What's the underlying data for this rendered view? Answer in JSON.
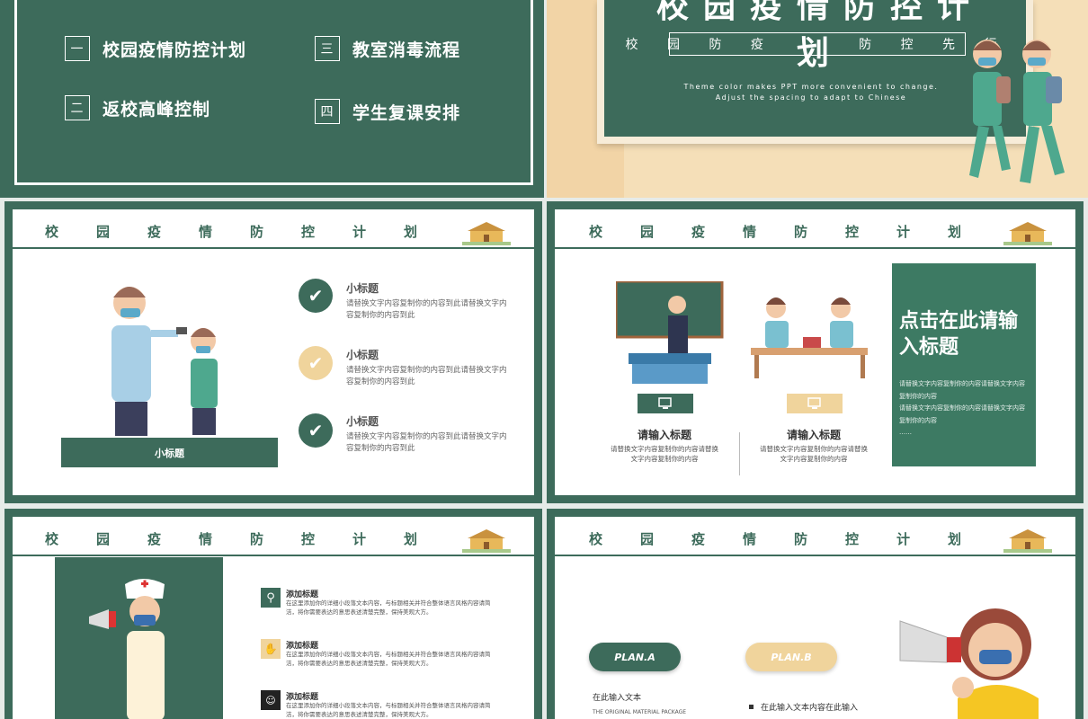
{
  "agenda": [
    {
      "num": "一",
      "label": "校园疫情防控计划"
    },
    {
      "num": "三",
      "label": "教室消毒流程"
    },
    {
      "num": "二",
      "label": "返校高峰控制"
    },
    {
      "num": "四",
      "label": "学生复课安排"
    }
  ],
  "cover": {
    "title": "校园疫情防控计划",
    "subtitle": "校 园 防 疫     防 控 先 行",
    "eng1": "Theme color makes PPT more convenient to change.",
    "eng2": "Adjust the spacing to adapt to Chinese"
  },
  "header_letters": [
    "校",
    "园",
    "疫",
    "情",
    "防",
    "控",
    "计",
    "划"
  ],
  "slide3": {
    "bar_label": "小标题",
    "items": [
      {
        "title": "小标题",
        "desc": "请替换文字内容复制你的内容到此请替换文字内容复制你的内容到此",
        "color": "#3d6b5b"
      },
      {
        "title": "小标题",
        "desc": "请替换文字内容复制你的内容到此请替换文字内容复制你的内容到此",
        "color": "#f0d49c"
      },
      {
        "title": "小标题",
        "desc": "请替换文字内容复制你的内容到此请替换文字内容复制你的内容到此",
        "color": "#3d6b5b"
      }
    ]
  },
  "slide4": {
    "col1_title": "请输入标题",
    "col1_desc": "请替换文字内容复制你的内容请替换文字内容复制你的内容",
    "col2_title": "请输入标题",
    "col2_desc": "请替换文字内容复制你的内容请替换文字内容复制你的内容",
    "panel_title": "点击在此请输入标题",
    "panel_desc": "请替换文字内容复制你的内容请替换文字内容复制你的内容\n请替换文字内容复制你的内容请替换文字内容复制你的内容\n……"
  },
  "slide5": {
    "items": [
      {
        "title": "添加标题",
        "desc": "在这里添加你的详细小段落文本内容，与标题相关并符合整体语言风格内容请简洁，将你需要表达的意思表述清楚完整，保持美观大方。"
      },
      {
        "title": "添加标题",
        "desc": "在这里添加你的详细小段落文本内容，与标题相关并符合整体语言风格内容请简洁，将你需要表达的意思表述清楚完整，保持美观大方。"
      },
      {
        "title": "添加标题",
        "desc": "在这里添加你的详细小段落文本内容，与标题相关并符合整体语言风格内容请简洁，将你需要表达的意思表述清楚完整，保持美观大方。"
      }
    ]
  },
  "slide6": {
    "planA": "PLAN.A",
    "planB": "PLAN.B",
    "textA": "在此输入文本",
    "engA": "THE ORIGINAL MATERIAL PACKAGE",
    "textB": "在此输入文本内容在此输入"
  },
  "colors": {
    "green": "#3d6b5b",
    "beige": "#f0d49c"
  }
}
